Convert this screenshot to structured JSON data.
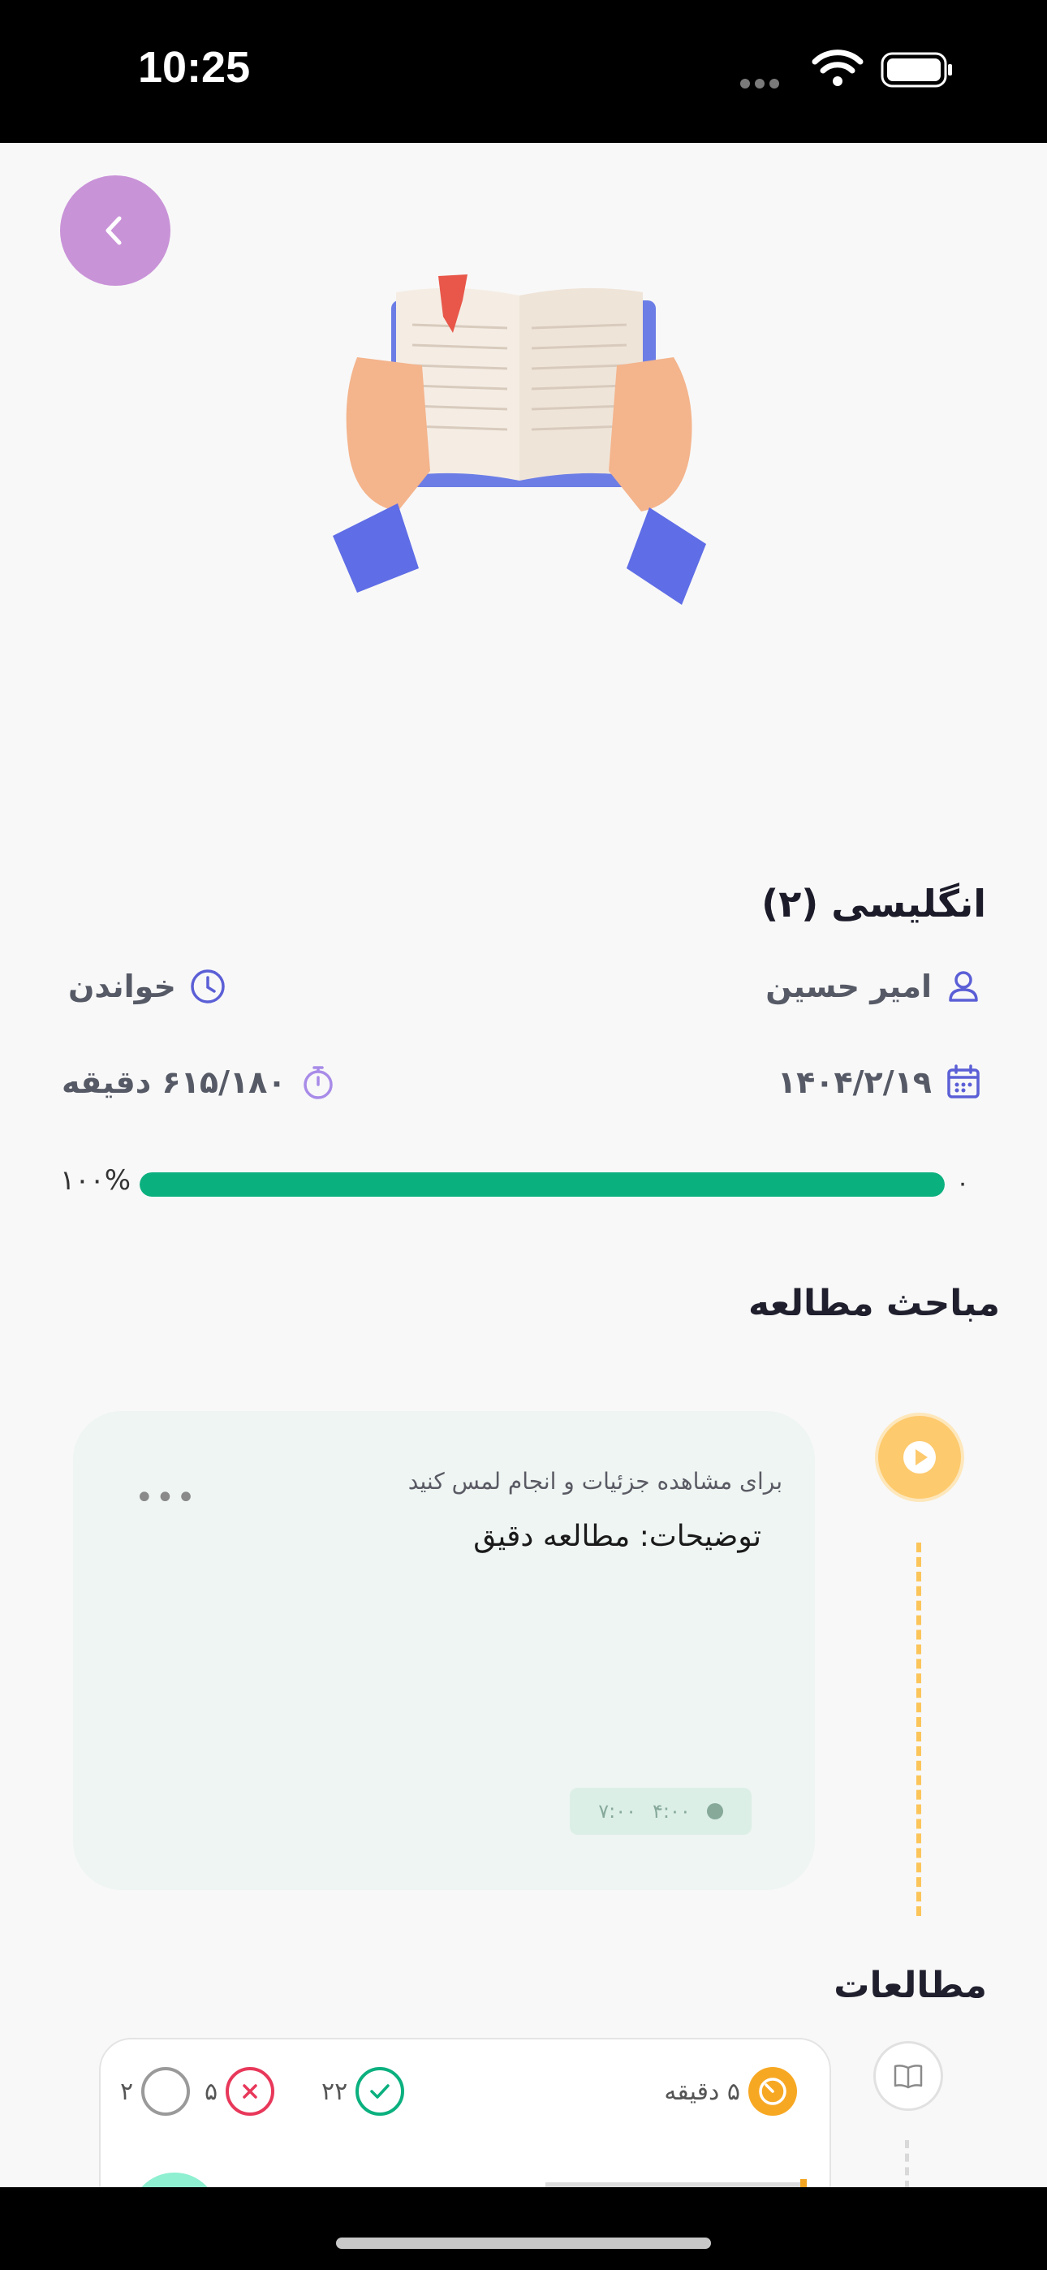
{
  "status_bar": {
    "time": "10:25"
  },
  "course": {
    "title": "انگلیسی (۲)",
    "teacher": "امیر حسین",
    "mode": "خواندن",
    "date": "۱۴۰۴/۲/۱۹",
    "duration": "۶۱۵/۱۸۰ دقیقه",
    "progress_percent_label": "۱۰۰%",
    "progress_start_label": "۰",
    "progress_value": 1.0
  },
  "sections": {
    "topics_title": "مباحث مطالعه",
    "studies_title": "مطالعات"
  },
  "topic_card": {
    "hint": "برای مشاهده جزئیات و انجام لمس کنید",
    "description": "توضیحات: مطالعه دقیق",
    "more": "•••",
    "time_start": "۴:۰۰",
    "time_end": "۷:۰۰"
  },
  "study_card": {
    "duration": "۵ دقیقه",
    "correct": "۲۲",
    "wrong": "۵",
    "blank": "۲"
  },
  "colors": {
    "accent_purple": "#c993d8",
    "progress_green": "#0bb07f",
    "timeline_orange": "#fdca6e",
    "card_mint": "#eef5f2",
    "icon_indigo": "#5b5fd6"
  }
}
